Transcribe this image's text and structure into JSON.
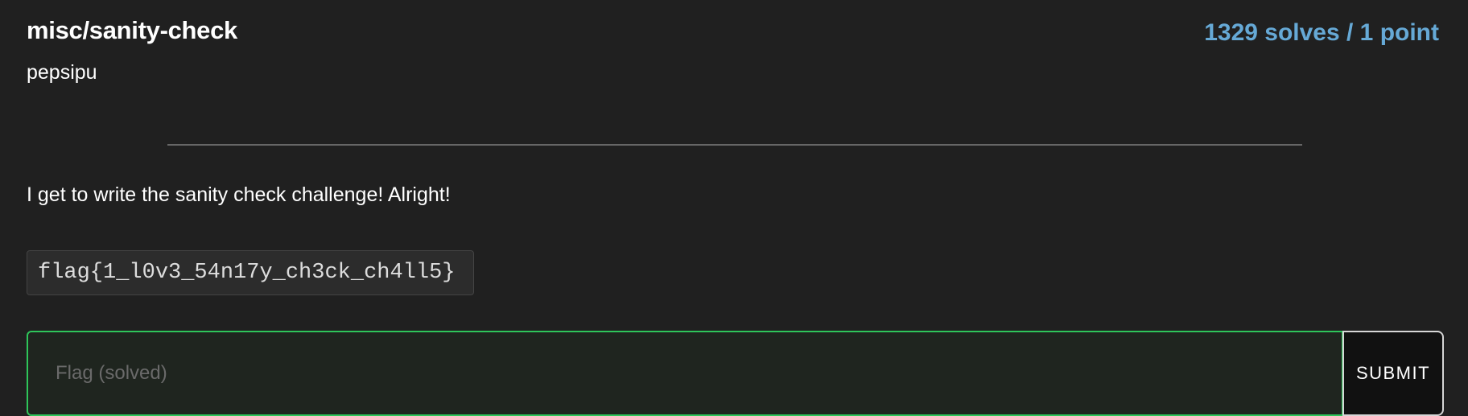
{
  "challenge": {
    "title": "misc/sanity-check",
    "solves_points": "1329 solves / 1 point",
    "author": "pepsipu",
    "description": "I get to write the sanity check challenge! Alright!",
    "flag_code": "flag{1_l0v3_54n17y_ch3ck_ch4ll5}"
  },
  "form": {
    "flag_placeholder": "Flag (solved)",
    "flag_value": "",
    "submit_label": "SUBMIT"
  },
  "colors": {
    "accent": "#66a9d6",
    "solved_border": "#2ec55a",
    "background": "#202020"
  }
}
